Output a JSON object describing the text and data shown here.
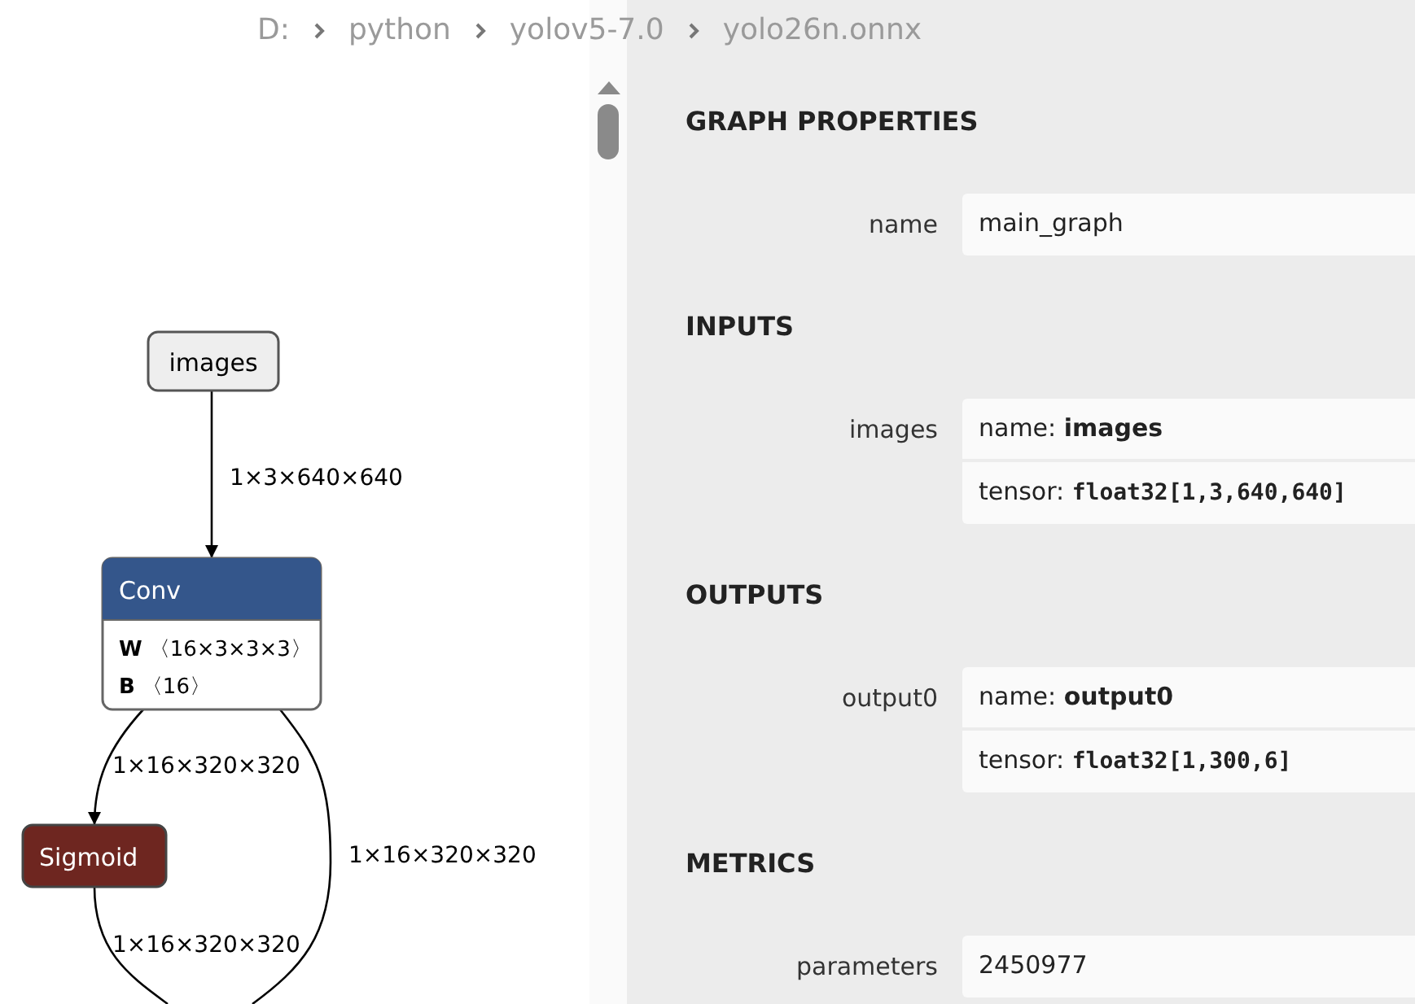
{
  "breadcrumb": [
    "D:",
    "python",
    "yolov5-7.0",
    "yolo26n.onnx"
  ],
  "graph": {
    "nodes": [
      {
        "kind": "input",
        "label": "images"
      },
      {
        "kind": "op",
        "label": "Conv",
        "color": "#34568b",
        "attributes": [
          {
            "name": "W",
            "value": "〈16×3×3×3〉"
          },
          {
            "name": "B",
            "value": "〈16〉"
          }
        ]
      },
      {
        "kind": "op",
        "label": "Sigmoid",
        "color": "#6e2620"
      }
    ],
    "edges": [
      {
        "label": "1×3×640×640"
      },
      {
        "label": "1×16×320×320"
      },
      {
        "label": "1×16×320×320"
      },
      {
        "label": "1×16×320×320"
      }
    ]
  },
  "properties": [
    {
      "title": "GRAPH PROPERTIES",
      "rows": [
        {
          "label": "name",
          "values": [
            {
              "kind": "text",
              "text": "main_graph"
            }
          ]
        }
      ]
    },
    {
      "title": "INPUTS",
      "rows": [
        {
          "label": "images",
          "values": [
            {
              "kind": "name",
              "text": "name: **images**"
            },
            {
              "kind": "tensor",
              "prefix": "tensor:",
              "text": "float32[1,3,640,640]"
            }
          ]
        }
      ]
    },
    {
      "title": "OUTPUTS",
      "rows": [
        {
          "label": "output0",
          "values": [
            {
              "kind": "name",
              "text": "name: **output0**"
            },
            {
              "kind": "tensor",
              "prefix": "tensor:",
              "text": "float32[1,300,6]"
            }
          ]
        }
      ]
    },
    {
      "title": "METRICS",
      "rows": [
        {
          "label": "parameters",
          "values": [
            {
              "kind": "text",
              "text": "2450977"
            }
          ]
        }
      ]
    }
  ]
}
